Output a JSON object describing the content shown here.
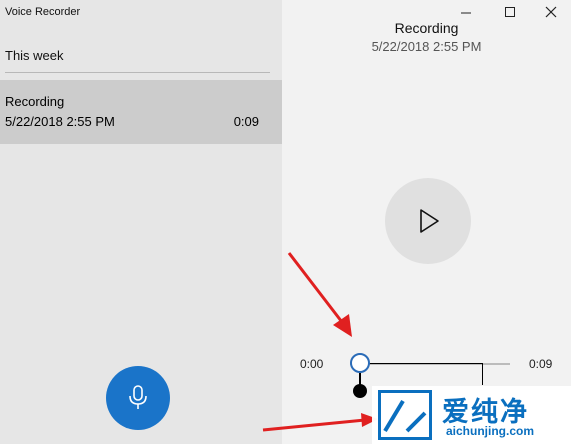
{
  "app": {
    "title": "Voice Recorder"
  },
  "list": {
    "section_header": "This week",
    "items": [
      {
        "name": "Recording",
        "date": "5/22/2018 2:55 PM",
        "duration": "0:09"
      }
    ]
  },
  "detail": {
    "title": "Recording",
    "date": "5/22/2018 2:55 PM",
    "time_start": "0:00",
    "time_end": "0:09",
    "progress": 0.0
  },
  "watermark": {
    "text": "爱纯净",
    "url": "aichunjing.com"
  },
  "colors": {
    "accent": "#1a74c9",
    "annotation_arrow": "#e02020",
    "watermark": "#0a6fbf"
  },
  "icons": {
    "record": "microphone-icon",
    "play": "play-icon",
    "minimize": "minimize-icon",
    "maximize": "maximize-icon",
    "close": "close-icon"
  }
}
